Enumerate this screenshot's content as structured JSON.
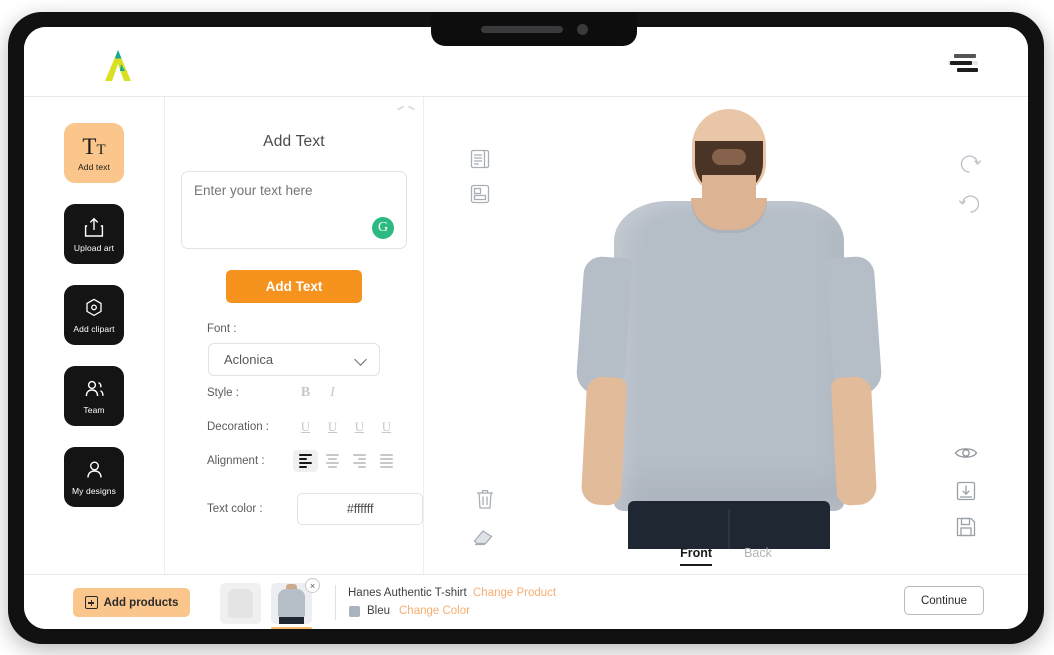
{
  "header": {
    "logo_name": "logo-a-mark",
    "menu_icon": "hamburger-menu-icon"
  },
  "tools": [
    {
      "label": "Add text",
      "icon": "text-tool-icon",
      "active": true
    },
    {
      "label": "Upload art",
      "icon": "upload-icon",
      "active": false
    },
    {
      "label": "Add clipart",
      "icon": "clipart-hexagon-icon",
      "active": false
    },
    {
      "label": "Team",
      "icon": "team-people-icon",
      "active": false
    },
    {
      "label": "My designs",
      "icon": "user-person-icon",
      "active": false
    }
  ],
  "panel": {
    "title": "Add Text",
    "text_value": "",
    "text_placeholder": "Enter your text here",
    "refresh_badge": "G",
    "add_text_label": "Add Text",
    "font_label": "Font :",
    "font_value": "Aclonica",
    "style_label": "Style :",
    "style_bold": "B",
    "style_italic": "I",
    "decoration_label": "Decoration :",
    "decoration_glyph": "U",
    "alignment_label": "Alignment :",
    "text_color_label": "Text color :",
    "text_color_value": "#ffffff"
  },
  "canvas": {
    "tabs": [
      {
        "label": "Front",
        "active": true
      },
      {
        "label": "Back",
        "active": false
      }
    ],
    "left_tools": [
      {
        "name": "layers-icon"
      },
      {
        "name": "template-icon"
      },
      {
        "name": "trash-icon"
      },
      {
        "name": "eraser-icon"
      }
    ],
    "right_tools": [
      {
        "name": "undo-icon"
      },
      {
        "name": "redo-icon"
      },
      {
        "name": "preview-eye-icon"
      },
      {
        "name": "download-icon"
      },
      {
        "name": "save-icon"
      }
    ],
    "shirt_color": "#b5bdc7"
  },
  "bottom": {
    "add_products_label": "Add products",
    "remove_glyph": "×",
    "product_name": "Hanes Authentic T-shirt",
    "change_product_label": "Change Product",
    "color_name": "Bleu",
    "color_hex": "#aab2bd",
    "change_color_label": "Change Color",
    "continue_label": "Continue"
  },
  "colors": {
    "accent_orange": "#f6921e",
    "accent_light_orange": "#fac68b",
    "link_orange": "#f5ae72",
    "dark": "#141414",
    "green": "#2cb982"
  }
}
